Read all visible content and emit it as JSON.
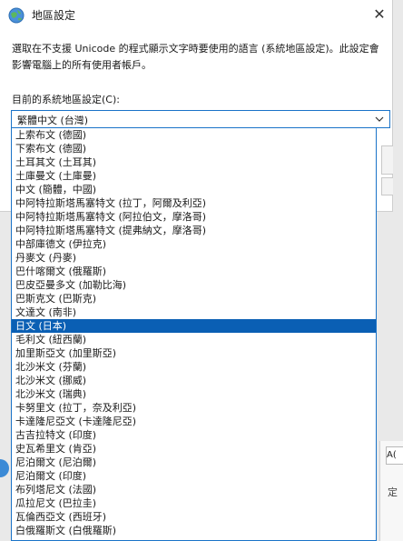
{
  "dialog": {
    "title": "地區設定",
    "close_label": "✕",
    "description": "選取在不支援 Unicode 的程式顯示文字時要使用的語言 (系統地區設定)。此設定會影響電腦上的所有使用者帳戶。",
    "locale_label": "目前的系統地區設定(C):",
    "current_locale": "繁體中文 (台灣)"
  },
  "background": {
    "input_fragment": "A(",
    "text_fragment": "定"
  },
  "dropdown": {
    "selected_index": 14,
    "items": [
      "上索布文 (德國)",
      "下索布文 (德國)",
      "土耳其文 (土耳其)",
      "土庫曼文 (土庫曼)",
      "中文 (簡體，中國)",
      "中阿特拉斯塔馬塞特文 (拉丁，阿爾及利亞)",
      "中阿特拉斯塔馬塞特文 (阿拉伯文，摩洛哥)",
      "中阿特拉斯塔馬塞特文 (提弗納文，摩洛哥)",
      "中部庫德文 (伊拉克)",
      "丹麥文 (丹麥)",
      "巴什喀爾文 (俄羅斯)",
      "巴皮亞曼多文 (加勒比海)",
      "巴斯克文 (巴斯克)",
      "文達文 (南非)",
      "日文 (日本)",
      "毛利文 (紐西蘭)",
      "加里斯亞文 (加里斯亞)",
      "北沙米文 (芬蘭)",
      "北沙米文 (挪威)",
      "北沙米文 (瑞典)",
      "卡努里文 (拉丁，奈及利亞)",
      "卡達隆尼亞文 (卡達隆尼亞)",
      "古吉拉特文 (印度)",
      "史瓦希里文 (肯亞)",
      "尼泊爾文 (尼泊爾)",
      "尼泊爾文 (印度)",
      "布列塔尼文 (法國)",
      "瓜拉尼文 (巴拉圭)",
      "瓦倫西亞文 (西班牙)",
      "白俄羅斯文 (白俄羅斯)"
    ]
  }
}
